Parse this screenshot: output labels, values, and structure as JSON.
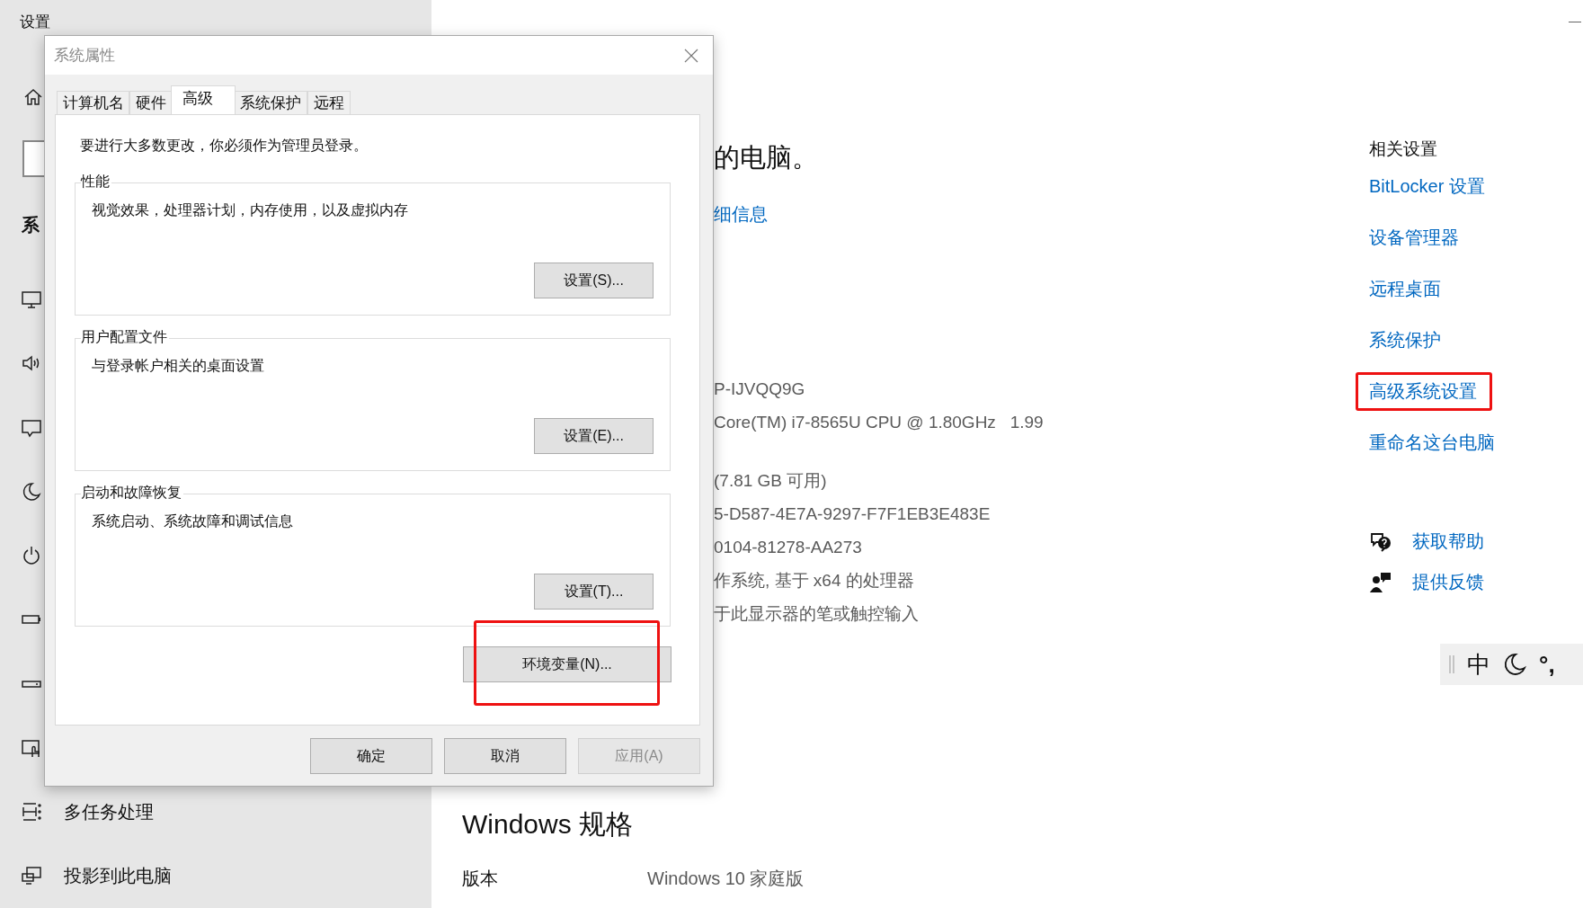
{
  "window": {
    "title": "设置"
  },
  "sidebar": {
    "heading": "系",
    "items": [
      {
        "label": "多任务处理"
      },
      {
        "label": "投影到此电脑"
      }
    ]
  },
  "main": {
    "heading": "的电脑。",
    "link": "细信息",
    "spec_lines": [
      "P-IJVQQ9G",
      "Core(TM) i7-8565U CPU @ 1.80GHz   1.99",
      "(7.81 GB 可用)",
      "5-D587-4E7A-9297-F7F1EB3E483E",
      "0104-81278-AA273",
      "作系统, 基于 x64 的处理器",
      "于此显示器的笔或触控输入"
    ],
    "windows_spec": {
      "heading": "Windows 规格",
      "rows": [
        {
          "label": "版本",
          "value": "Windows 10 家庭版"
        }
      ]
    }
  },
  "related": {
    "heading": "相关设置",
    "links": [
      {
        "label": "BitLocker 设置",
        "highlighted": false
      },
      {
        "label": "设备管理器",
        "highlighted": false
      },
      {
        "label": "远程桌面",
        "highlighted": false
      },
      {
        "label": "系统保护",
        "highlighted": false
      },
      {
        "label": "高级系统设置",
        "highlighted": true
      },
      {
        "label": "重命名这台电脑",
        "highlighted": false
      }
    ],
    "help": [
      {
        "label": "获取帮助",
        "kind": "help"
      },
      {
        "label": "提供反馈",
        "kind": "feedback"
      }
    ]
  },
  "ime_bar": {
    "mode": "中",
    "punctuation": "°,"
  },
  "dialog": {
    "title": "系统属性",
    "tabs": [
      {
        "label": "计算机名",
        "selected": false
      },
      {
        "label": "硬件",
        "selected": false
      },
      {
        "label": "高级",
        "selected": true
      },
      {
        "label": "系统保护",
        "selected": false
      },
      {
        "label": "远程",
        "selected": false
      }
    ],
    "note": "要进行大多数更改，你必须作为管理员登录。",
    "groups": [
      {
        "title": "性能",
        "description": "视觉效果，处理器计划，内存使用，以及虚拟内存",
        "button": "设置(S)..."
      },
      {
        "title": "用户配置文件",
        "description": "与登录帐户相关的桌面设置",
        "button": "设置(E)..."
      },
      {
        "title": "启动和故障恢复",
        "description": "系统启动、系统故障和调试信息",
        "button": "设置(T)..."
      }
    ],
    "env_button": {
      "label": "环境变量(N)...",
      "highlighted": true
    },
    "buttons": [
      {
        "label": "确定",
        "disabled": false
      },
      {
        "label": "取消",
        "disabled": false
      },
      {
        "label": "应用(A)",
        "disabled": true
      }
    ]
  }
}
